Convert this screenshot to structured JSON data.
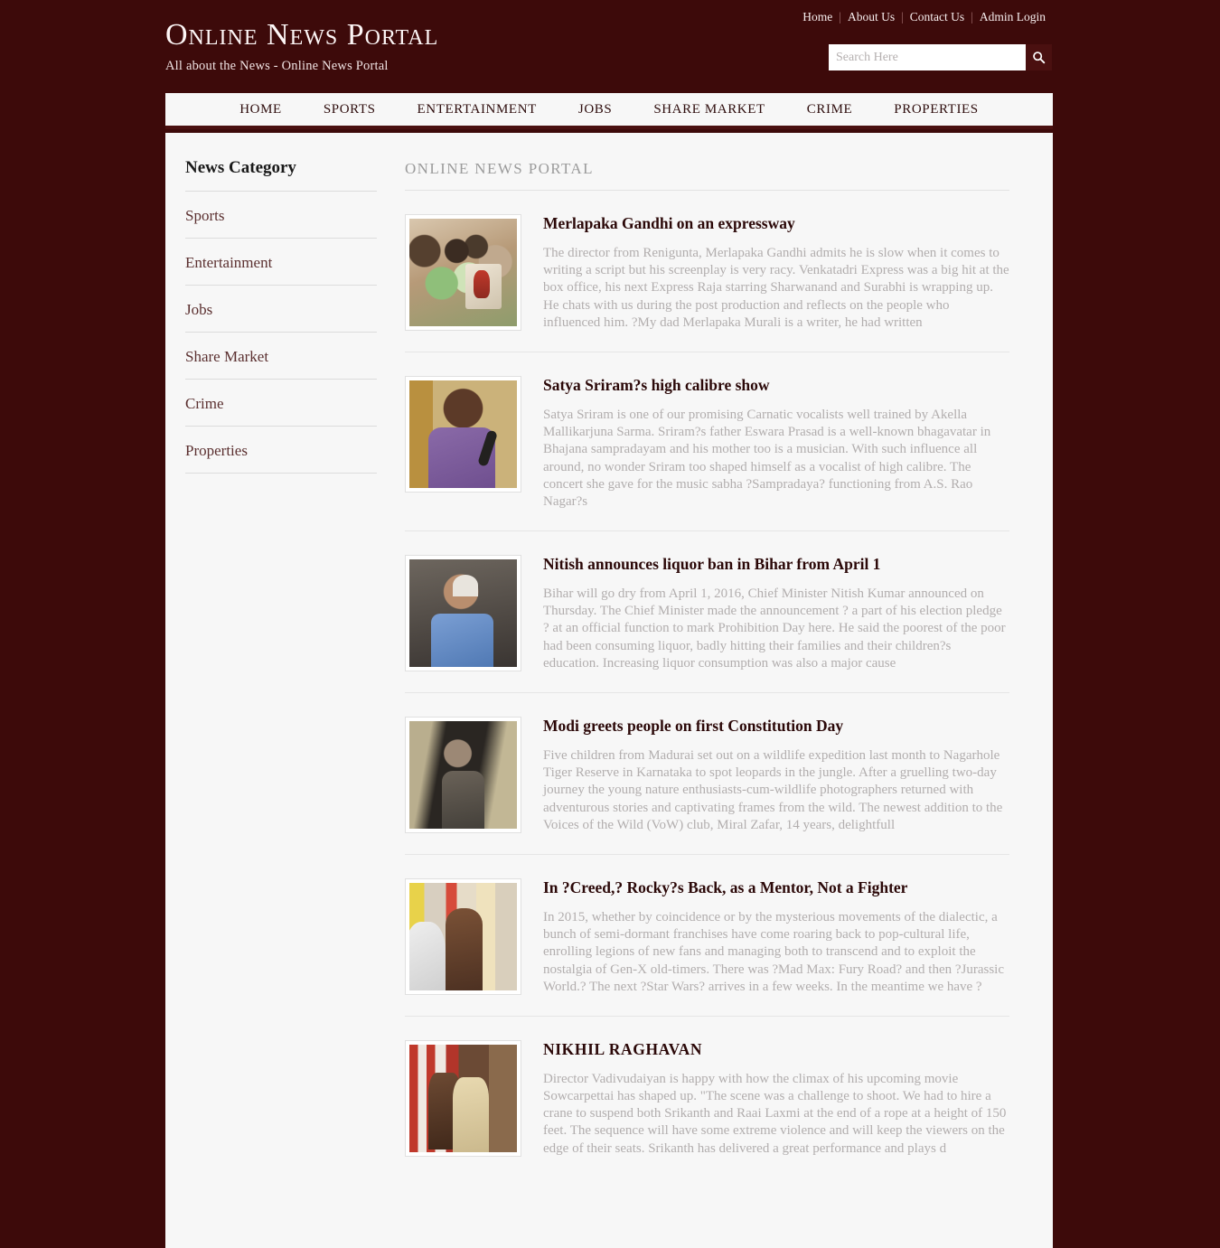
{
  "header": {
    "brand_title": "Online News Portal",
    "tagline": "All about the News - Online News Portal",
    "top_links": [
      "Home",
      "About Us",
      "Contact Us",
      "Admin Login"
    ],
    "search": {
      "placeholder": "Search Here",
      "value": "",
      "icon": "search-icon"
    }
  },
  "nav": {
    "items": [
      "HOME",
      "SPORTS",
      "ENTERTAINMENT",
      "JOBS",
      "SHARE MARKET",
      "CRIME",
      "PROPERTIES"
    ]
  },
  "sidebar": {
    "heading": "News Category",
    "items": [
      "Sports",
      "Entertainment",
      "Jobs",
      "Share Market",
      "Crime",
      "Properties"
    ]
  },
  "main": {
    "section_title": "ONLINE NEWS PORTAL",
    "articles": [
      {
        "title": "Merlapaka Gandhi on an expressway",
        "text": "The director from Renigunta, Merlapaka Gandhi admits he is slow when it comes to writing a script but his screenplay is very racy. Venkatadri Express was a big hit at the box office, his next Express Raja starring Sharwanand and Surabhi is wrapping up. He chats with us during the post production and reflects on the people who influenced him. ?My dad Merlapaka Murali is a writer, he had written",
        "thumb": "crowd-selfie-photo"
      },
      {
        "title": "Satya Sriram?s high calibre show",
        "text": "Satya Sriram is one of our promising Carnatic vocalists well trained by Akella Mallikarjuna Sarma. Sriram?s father Eswara Prasad is a well-known bhagavatar in Bhajana sampradayam and his mother too is a musician. With such influence all around, no wonder Sriram too shaped himself as a vocalist of high calibre. The concert she gave for the music sabha ?Sampradaya? functioning from A.S. Rao Nagar?s",
        "thumb": "singer-with-microphone-photo"
      },
      {
        "title": "Nitish announces liquor ban in Bihar from April 1",
        "text": "Bihar will go dry from April 1, 2016, Chief Minister Nitish Kumar announced on Thursday. The Chief Minister made the announcement ? a part of his election pledge ? at an official function to mark Prohibition Day here. He said the poorest of the poor had been consuming liquor, badly hitting their families and their children?s education. Increasing liquor consumption was also a major cause",
        "thumb": "politician-in-crowd-photo"
      },
      {
        "title": "Modi greets people on first Constitution Day",
        "text": "Five children from Madurai set out on a wildlife expedition last month to Nagarhole Tiger Reserve in Karnataka to spot leopards in the jungle. After a gruelling two-day journey the young nature enthusiasts-cum-wildlife photographers returned with adventurous stories and captivating frames from the wild. The newest addition to the Voices of the Wild (VoW) club, Miral Zafar, 14 years, delightfull",
        "thumb": "portrait-dark-photo"
      },
      {
        "title": "In ?Creed,? Rocky?s Back, as a Mentor, Not a Fighter",
        "text": "In 2015, whether by coincidence or by the mysterious movements of the dialectic, a bunch of semi-dormant franchises have come roaring back to pop-cultural life, enrolling legions of new fans and managing both to transcend and to exploit the nostalgia of Gen-X old-timers. There was ?Mad Max: Fury Road? and then ?Jurassic World.? The next ?Star Wars? arrives in a few weeks. In the meantime we have ?",
        "thumb": "boxing-gym-photo"
      },
      {
        "title": "NIKHIL RAGHAVAN",
        "text": "Director Vadivudaiyan is happy with how the climax of his upcoming movie Sowcarpettai has shaped up. \"The scene was a challenge to shoot. We had to hire a crane to suspend both Srikanth and Raai Laxmi at the end of a rope at a height of 150 feet. The sequence will have some extreme violence and will keep the viewers on the edge of their seats. Srikanth has delivered a great performance and plays d",
        "thumb": "movie-still-photo"
      }
    ]
  },
  "colors": {
    "page_background": "#3d0a0a",
    "content_background": "#f7f7f7",
    "accent_dark": "#4a1010",
    "title_text": "#2b0808",
    "body_text": "#b2aeae"
  }
}
